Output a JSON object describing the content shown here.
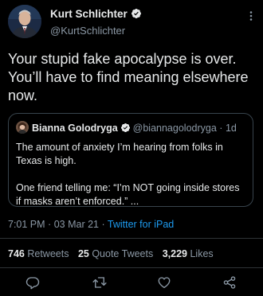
{
  "author": {
    "name": "Kurt Schlichter",
    "handle": "@KurtSchlichter",
    "avatar_icon": "person-avatar",
    "verified": true
  },
  "tweet": {
    "lines": [
      "Your stupid fake apocalypse is over.",
      "You’ll have to find meaning elsewhere",
      "now."
    ]
  },
  "quoted_tweet": {
    "name": "Bianna Golodryga",
    "handle": "@biannagolodryga",
    "separator": "·",
    "time": "1d",
    "verified": true,
    "paragraphs": [
      [
        "The amount of anxiety I’m hearing from folks in",
        "Texas is high."
      ],
      [
        "One friend telling me: “I’m NOT going inside stores",
        "if masks aren’t enforced.” ..."
      ]
    ]
  },
  "meta": {
    "time": "7:01 PM",
    "separator1": "·",
    "date": "03 Mar 21",
    "separator2": "·",
    "source": "Twitter for iPad"
  },
  "stats": {
    "retweets_count": "746",
    "retweets_label": "Retweets",
    "quotes_count": "25",
    "quotes_label": "Quote Tweets",
    "likes_count": "3,229",
    "likes_label": "Likes"
  },
  "actions": [
    "reply-icon",
    "retweet-icon",
    "like-icon",
    "share-icon"
  ],
  "colors": {
    "background": "#000000",
    "text": "#e7e9ea",
    "secondary": "#8b98a5",
    "link": "#1d9bf0",
    "verified": "#1d9bf0",
    "border": "#38444d"
  }
}
